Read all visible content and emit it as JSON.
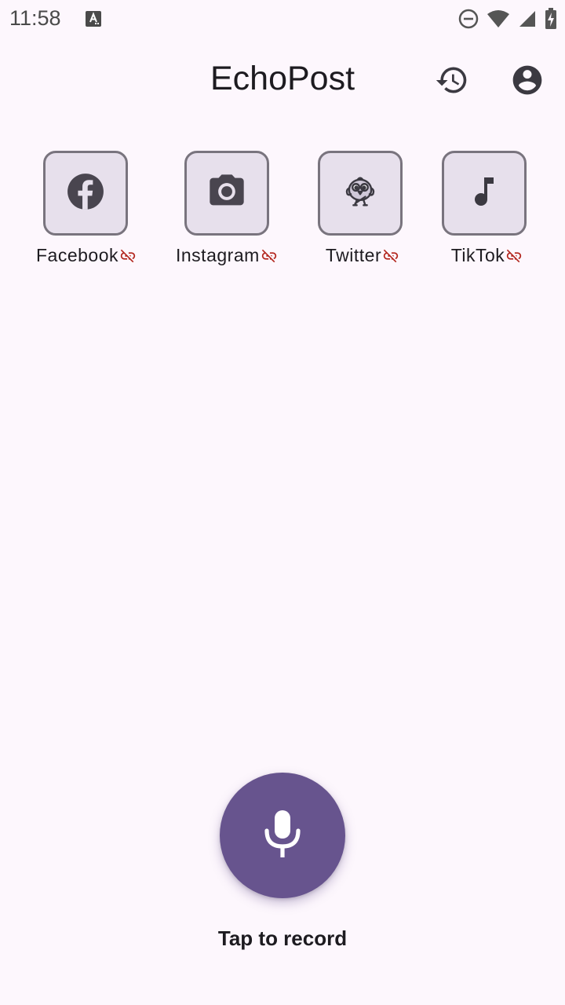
{
  "status_bar": {
    "time": "11:58"
  },
  "app_bar": {
    "title": "EchoPost",
    "actions": [
      {
        "name": "history-icon"
      },
      {
        "name": "account-circle-icon"
      }
    ]
  },
  "platforms": [
    {
      "label": "Facebook",
      "icon": "facebook-icon",
      "link_status_icon": "link-off-icon"
    },
    {
      "label": "Instagram",
      "icon": "camera-icon",
      "link_status_icon": "link-off-icon"
    },
    {
      "label": "Twitter",
      "icon": "bird-icon",
      "link_status_icon": "link-off-icon"
    },
    {
      "label": "TikTok",
      "icon": "music-note-icon",
      "link_status_icon": "link-off-icon"
    }
  ],
  "record": {
    "icon": "microphone-icon",
    "label": "Tap to record"
  },
  "colors": {
    "background": "#fdf7fd",
    "primary": "#67548e",
    "tile_background": "#e7e0ec",
    "tile_border": "#79747e",
    "link_off": "#b3261e"
  }
}
